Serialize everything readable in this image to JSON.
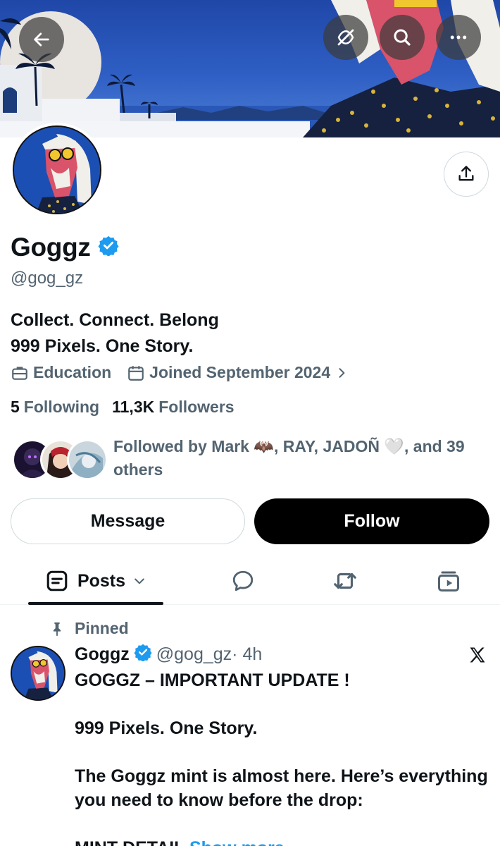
{
  "header": {
    "back_icon": "arrow-left-icon",
    "hide_icon": "eye-off-icon",
    "search_icon": "search-icon",
    "more_icon": "ellipsis-icon"
  },
  "profile": {
    "name": "Goggz",
    "handle": "@gog_gz",
    "bio_line1": "Collect. Connect. Belong",
    "bio_line2": "999 Pixels. One Story.",
    "category": "Education",
    "joined": "Joined September 2024",
    "following_count": "5",
    "following_label": "Following",
    "followers_count": "11,3K",
    "followers_label": "Followers",
    "followed_by": "Followed by Mark 🦇, RAY, JADOÑ 🤍, and 39 others",
    "verified_color": "#1d9bf0"
  },
  "actions": {
    "message": "Message",
    "follow": "Follow"
  },
  "tabs": {
    "posts": "Posts"
  },
  "post": {
    "pinned_label": "Pinned",
    "author": "Goggz",
    "handle": "@gog_gz",
    "time": "· 4h",
    "line1": "GOGGZ – IMPORTANT UPDATE !",
    "line2": "999 Pixels. One Story.",
    "line3": "The Goggz mint is almost here. Here’s everything you need to know before the drop:",
    "line4_prefix": "MINT DETAIL",
    "show_more": "Show more"
  }
}
